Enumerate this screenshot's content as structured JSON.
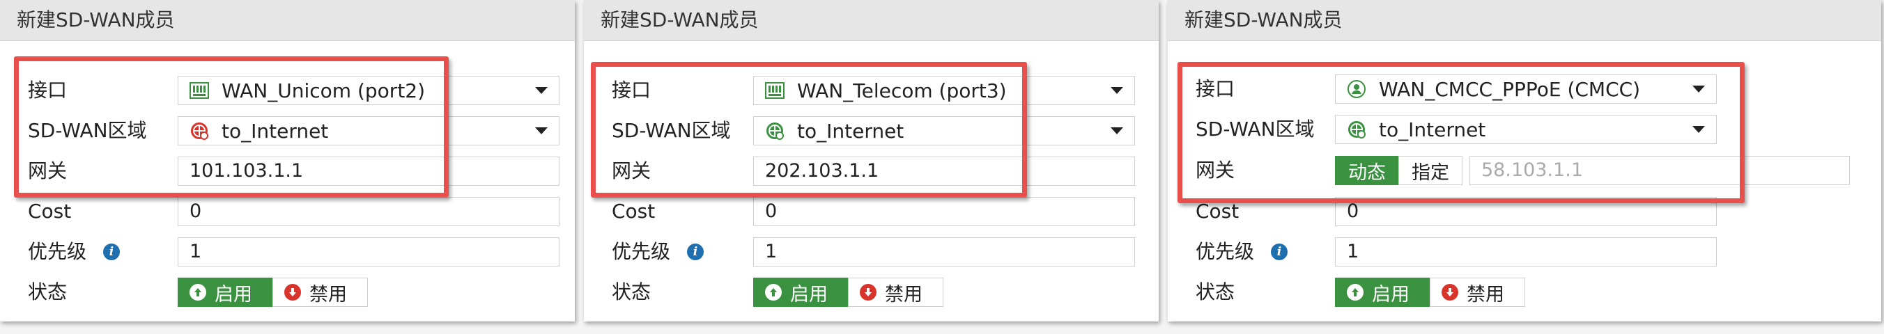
{
  "panels": [
    {
      "title": "新建SD-WAN成员",
      "interface": {
        "label": "接口",
        "value": "WAN_Unicom (port2)",
        "icon": "ethernet-port-icon"
      },
      "zone": {
        "label": "SD-WAN区域",
        "value": "to_Internet",
        "icon": "sdwan-zone-icon",
        "icon_color": "#d9342b"
      },
      "gateway": {
        "label": "网关",
        "value": "101.103.1.1"
      },
      "cost": {
        "label": "Cost",
        "value": "0"
      },
      "priority": {
        "label": "优先级",
        "value": "1"
      },
      "status": {
        "label": "状态",
        "enable": "启用",
        "disable": "禁用",
        "selected": "enable"
      }
    },
    {
      "title": "新建SD-WAN成员",
      "interface": {
        "label": "接口",
        "value": "WAN_Telecom (port3)",
        "icon": "ethernet-port-icon"
      },
      "zone": {
        "label": "SD-WAN区域",
        "value": "to_Internet",
        "icon": "sdwan-zone-icon",
        "icon_color": "#3a913f"
      },
      "gateway": {
        "label": "网关",
        "value": "202.103.1.1"
      },
      "cost": {
        "label": "Cost",
        "value": "0"
      },
      "priority": {
        "label": "优先级",
        "value": "1"
      },
      "status": {
        "label": "状态",
        "enable": "启用",
        "disable": "禁用",
        "selected": "enable"
      }
    },
    {
      "title": "新建SD-WAN成员",
      "interface": {
        "label": "接口",
        "value": "WAN_CMCC_PPPoE (CMCC)",
        "icon": "pppoe-user-icon"
      },
      "zone": {
        "label": "SD-WAN区域",
        "value": "to_Internet",
        "icon": "sdwan-zone-icon",
        "icon_color": "#3a913f"
      },
      "gateway": {
        "label": "网关",
        "dynamic": "动态",
        "specify": "指定",
        "selected": "dynamic",
        "value": "58.103.1.1"
      },
      "cost": {
        "label": "Cost",
        "value": "0"
      },
      "priority": {
        "label": "优先级",
        "value": "1"
      },
      "status": {
        "label": "状态",
        "enable": "启用",
        "disable": "禁用",
        "selected": "enable"
      }
    }
  ],
  "colors": {
    "highlight": "#e9504b",
    "enabled_green": "#3a913f",
    "info_blue": "#1d6fb0",
    "disable_red": "#d9342b"
  }
}
